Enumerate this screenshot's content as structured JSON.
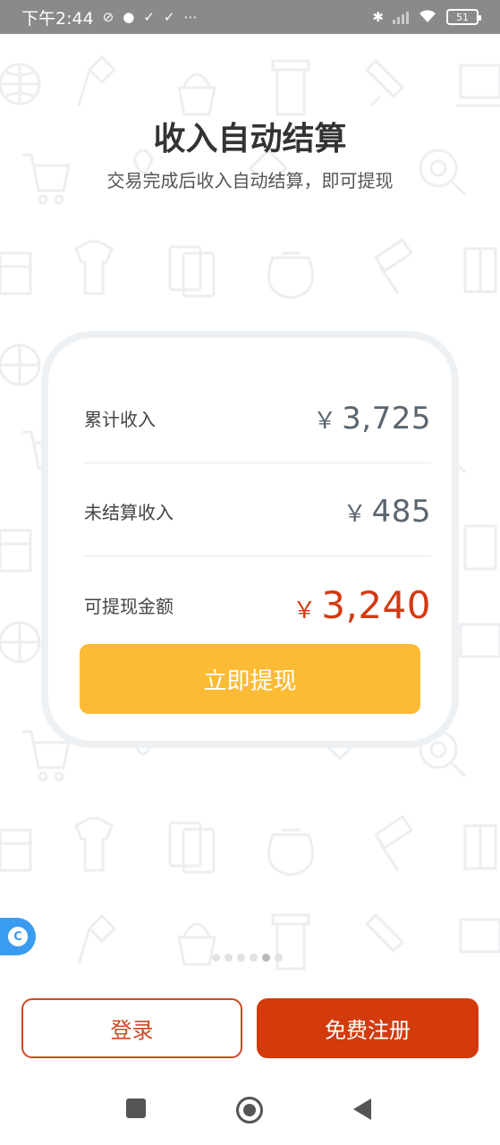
{
  "status_bar": {
    "time": "下午2:44",
    "battery": "51"
  },
  "headline": "收入自动结算",
  "subline": "交易完成后收入自动结算，即可提现",
  "income_card": {
    "rows": [
      {
        "label": "累计收入",
        "currency": "￥",
        "amount": "3,725"
      },
      {
        "label": "未结算收入",
        "currency": "￥",
        "amount": "485"
      },
      {
        "label": "可提现金额",
        "currency": "￥",
        "amount": "3,240"
      }
    ],
    "withdraw_label": "立即提现"
  },
  "pager": {
    "total": 6,
    "active_index": 4
  },
  "actions": {
    "login_label": "登录",
    "register_label": "免费注册"
  },
  "colors": {
    "accent": "#d33a0c",
    "withdraw_button": "#fbbb35",
    "amount_highlight": "#d33a12",
    "side_tab": "#3a9cf0"
  }
}
